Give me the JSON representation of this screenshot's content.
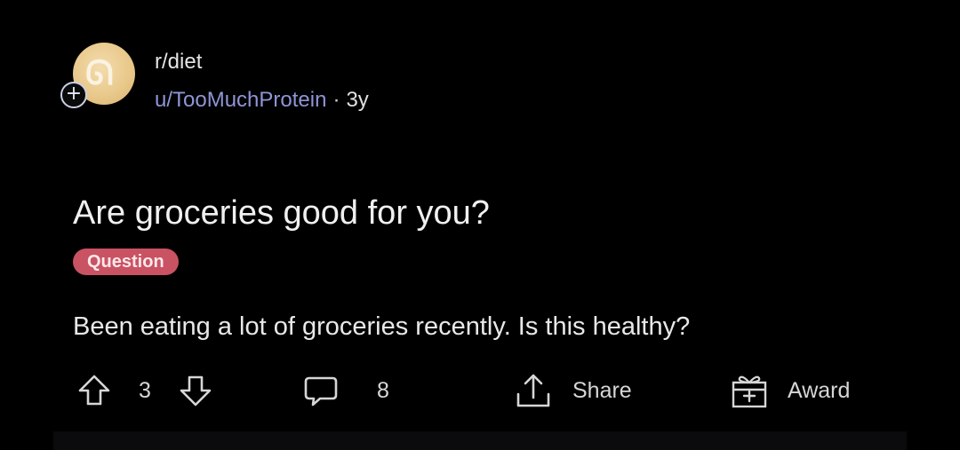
{
  "post": {
    "subreddit": "r/diet",
    "author": "u/TooMuchProtein",
    "separator": "·",
    "age": "3y",
    "title": "Are groceries good for you?",
    "flair": "Question",
    "body": "Been eating a lot of groceries recently. Is this healthy?"
  },
  "actions": {
    "vote_count": "3",
    "comment_count": "8",
    "share_label": "Share",
    "award_label": "Award"
  },
  "icons": {
    "upvote": "arrow-up-outline-icon",
    "downvote": "arrow-down-outline-icon",
    "comment": "speech-bubble-icon",
    "share": "share-upload-icon",
    "award": "gift-box-icon",
    "join": "plus-circle-icon"
  },
  "colors": {
    "background": "#000000",
    "flair_background": "#c95263",
    "author_color": "#8f95d6",
    "text": "#e8e8e8"
  }
}
